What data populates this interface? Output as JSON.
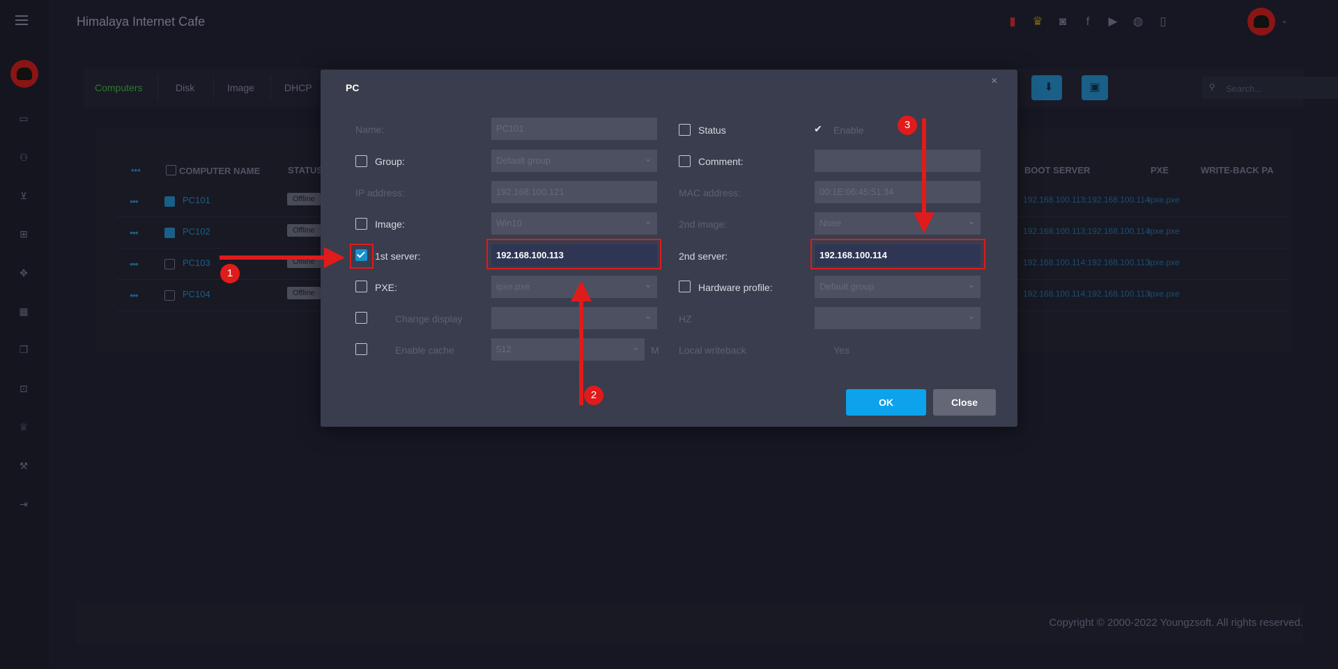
{
  "app": {
    "title": "Himalaya Internet Cafe",
    "accent": "#0ca2ec"
  },
  "sidebar": {
    "icons": [
      "monitor-icon",
      "users-icon",
      "cart-icon",
      "windows-icon",
      "gamepad-icon",
      "calendar-icon",
      "copy-icon",
      "lock-icon",
      "crown-icon",
      "tools-icon",
      "logout-icon"
    ]
  },
  "header_icons": [
    "chart-icon",
    "trophy-icon",
    "discord-icon",
    "facebook-icon",
    "youtube-icon",
    "globe-icon",
    "book-icon"
  ],
  "toolbar": {
    "tabs": [
      "Computers",
      "Disk",
      "Image",
      "DHCP"
    ],
    "search_placeholder": "Search..."
  },
  "table": {
    "headers": {
      "computer_name": "COMPUTER NAME",
      "status": "STATUS",
      "boot_server": "BOOT SERVER",
      "pxe": "PXE",
      "write_back": "WRITE-BACK PA"
    },
    "rows": [
      {
        "name": "PC101",
        "status": "Offline",
        "boot": "192.168.100.113;192.168.100.114",
        "pxe": "ipxe.pxe"
      },
      {
        "name": "PC102",
        "status": "Offline",
        "boot": "192.168.100.113;192.168.100.114",
        "pxe": "ipxe.pxe"
      },
      {
        "name": "PC103",
        "status": "Offline",
        "boot": "192.168.100.114;192.168.100.113",
        "pxe": "ipxe.pxe"
      },
      {
        "name": "PC104",
        "status": "Offline",
        "boot": "192.168.100.114;192.168.100.113",
        "pxe": "ipxe.pxe"
      }
    ]
  },
  "footer": {
    "copyright": "Copyright © 2000-2022 Youngzsoft. All rights reserved."
  },
  "modal": {
    "title": "PC",
    "close_symbol": "×",
    "labels": {
      "name": "Name:",
      "group": "Group:",
      "ip": "IP address:",
      "image": "Image:",
      "server1": "1st server:",
      "pxe": "PXE:",
      "change_display": "Change display",
      "enable_cache": "Enable cache",
      "status": "Status",
      "comment": "Comment:",
      "mac": "MAC address:",
      "image2": "2nd image:",
      "server2": "2nd server:",
      "hardware": "Hardware profile:",
      "hz": "HZ",
      "local_writeback": "Local writeback"
    },
    "values": {
      "name": "PC101",
      "group": "Default group",
      "ip": "192.168.100.121",
      "image": "Win10",
      "server1": "192.168.100.113",
      "pxe": "ipxe.pxe",
      "change_display": "",
      "enable_cache": "512",
      "cache_unit": "M",
      "status": "Enable",
      "comment": "",
      "mac": "00:1E:06:45:51:34",
      "image2": "None",
      "server2": "192.168.100.114",
      "hardware": "Default group",
      "hz": "",
      "local_writeback": "Yes"
    },
    "buttons": {
      "ok": "OK",
      "close": "Close"
    }
  },
  "annotations": {
    "markers": [
      "1",
      "2",
      "3"
    ],
    "color": "#e01b1b"
  }
}
